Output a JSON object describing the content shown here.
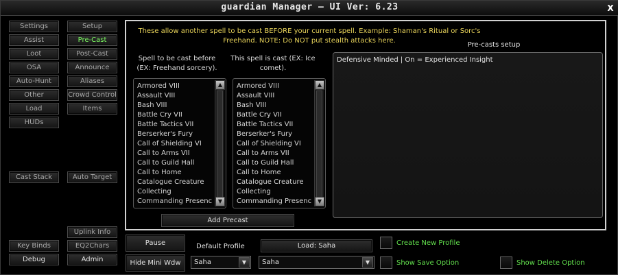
{
  "window": {
    "title": "guardian Manager  — UI Ver: 6.23",
    "close_label": "X"
  },
  "nav": {
    "left_col": [
      "Settings",
      "Assist",
      "Loot",
      "OSA",
      "Auto-Hunt",
      "Other",
      "Load",
      "HUDs"
    ],
    "right_col": [
      "Setup",
      "Pre-Cast",
      "Post-Cast",
      "Announce",
      "Aliases",
      "Crowd Control",
      "Items"
    ],
    "cast_stack": "Cast Stack",
    "auto_target": "Auto Target",
    "uplink_info": "Uplink Info",
    "key_binds": "Key Binds",
    "eq2chars": "EQ2Chars",
    "debug": "Debug",
    "admin": "Admin",
    "active": "Pre-Cast"
  },
  "precast": {
    "info": "These allow another spell to be cast BEFORE your current spell. Example: Shaman's Ritual or Sorc's Freehand. NOTE: Do NOT put stealth attacks here.",
    "setup_title": "Pre-casts setup",
    "col1_header": "Spell to be cast before (EX: Freehand sorcery).",
    "col2_header": "This spell is cast (EX: Ice comet).",
    "spells": [
      "Armored VIII",
      "Assault VIII",
      "Bash VIII",
      "Battle Cry VII",
      "Battle Tactics VII",
      "Berserker's Fury",
      "Call of Shielding VI",
      "Call to Arms VII",
      "Call to Guild Hall",
      "Call to Home",
      "Catalogue Creature",
      "Collecting",
      "Commanding Presence"
    ],
    "setup_entry": "Defensive Minded | On = Experienced Insight",
    "add_button": "Add Precast"
  },
  "footer": {
    "pause": "Pause",
    "hide_mini": "Hide Mini Wdw",
    "default_profile_label": "Default Profile",
    "load_button": "Load: Saha",
    "default_profile_value": "Saha",
    "profile_value": "Saha",
    "create_new_profile": "Create New Profile",
    "show_save_option": "Show Save Option",
    "show_delete_option": "Show Delete Option"
  },
  "icons": {
    "close": "close-icon",
    "scroll_up": "chevron-up-icon",
    "scroll_down": "chevron-down-icon",
    "dropdown": "chevron-down-icon"
  },
  "colors": {
    "active_green": "#7dff63",
    "info_yellow": "#e8d35a"
  }
}
